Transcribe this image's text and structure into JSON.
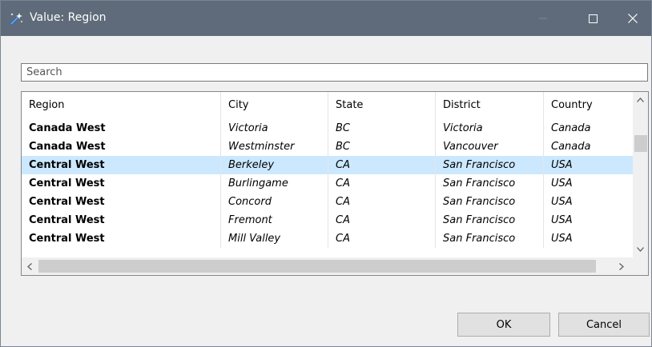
{
  "window": {
    "title": "Value: Region",
    "icon": "wand-icon",
    "controls": [
      "minimize",
      "maximize",
      "close"
    ]
  },
  "search": {
    "placeholder": "Search",
    "value": ""
  },
  "grid": {
    "columns": [
      "Region",
      "City",
      "State",
      "District",
      "Country"
    ],
    "rows": [
      [
        "Canada West",
        "Victoria",
        "BC",
        "Victoria",
        "Canada"
      ],
      [
        "Canada West",
        "Westminster",
        "BC",
        "Vancouver",
        "Canada"
      ],
      [
        "Central West",
        "Berkeley",
        "CA",
        "San Francisco",
        "USA"
      ],
      [
        "Central West",
        "Burlingame",
        "CA",
        "San Francisco",
        "USA"
      ],
      [
        "Central West",
        "Concord",
        "CA",
        "San Francisco",
        "USA"
      ],
      [
        "Central West",
        "Fremont",
        "CA",
        "San Francisco",
        "USA"
      ],
      [
        "Central West",
        "Mill Valley",
        "CA",
        "San Francisco",
        "USA"
      ]
    ],
    "selected_row_index": 2
  },
  "buttons": {
    "ok": "OK",
    "cancel": "Cancel"
  },
  "colors": {
    "titlebar": "#5f6b7a",
    "selection": "#cce8ff"
  }
}
